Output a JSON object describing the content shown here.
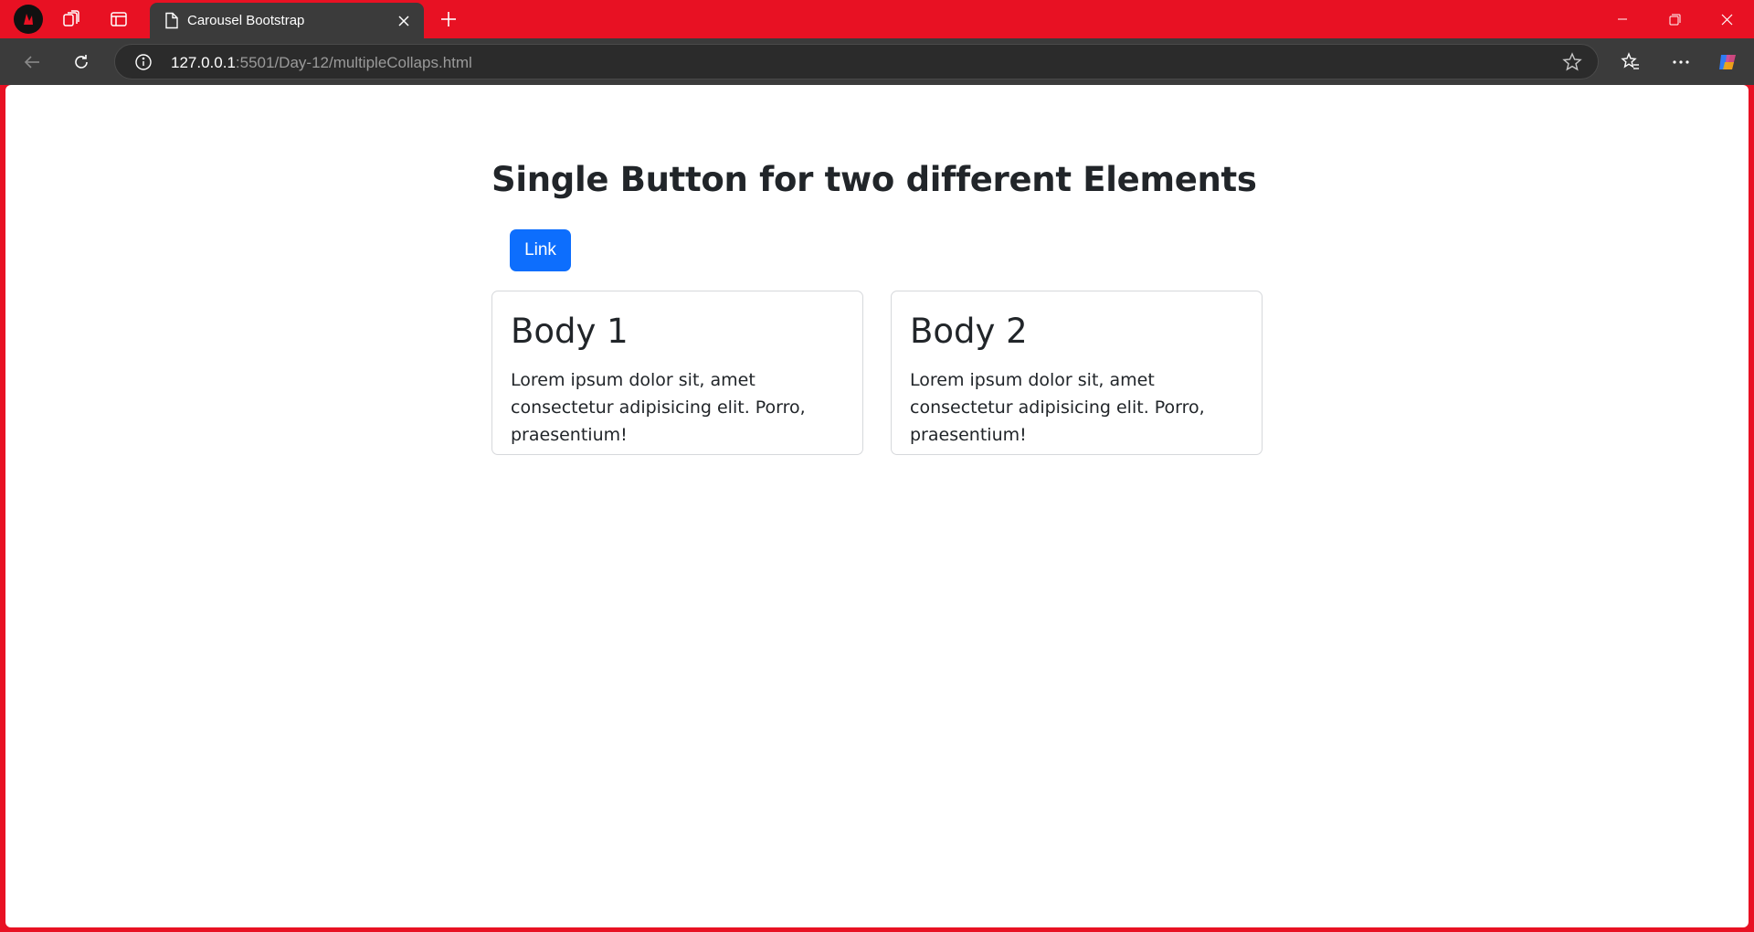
{
  "browser": {
    "tab": {
      "title": "Carousel Bootstrap"
    },
    "address": {
      "host": "127.0.0.1",
      "rest": ":5501/Day-12/multipleCollaps.html"
    },
    "icons": {
      "profile": "profile-avatar-icon",
      "collections": "collections-icon",
      "tab_actions": "tab-actions-icon",
      "page": "page-icon",
      "close_tab": "close-icon",
      "new_tab": "plus-icon",
      "back": "back-arrow-icon",
      "refresh": "refresh-icon",
      "info": "info-icon",
      "favorite": "star-icon",
      "favorites": "favorites-icon",
      "more": "more-icon",
      "copilot": "copilot-icon"
    },
    "colors": {
      "titlebar": "#e81123",
      "toolbar": "#3b3b3b"
    }
  },
  "page": {
    "heading": "Single Button for two different Elements",
    "button": {
      "label": "Link",
      "color": "#0d6efd"
    },
    "cards": [
      {
        "title": "Body 1",
        "text": "Lorem ipsum dolor sit, amet consectetur adipisicing elit. Porro, praesentium!"
      },
      {
        "title": "Body 2",
        "text": "Lorem ipsum dolor sit, amet consectetur adipisicing elit. Porro, praesentium!"
      }
    ]
  }
}
